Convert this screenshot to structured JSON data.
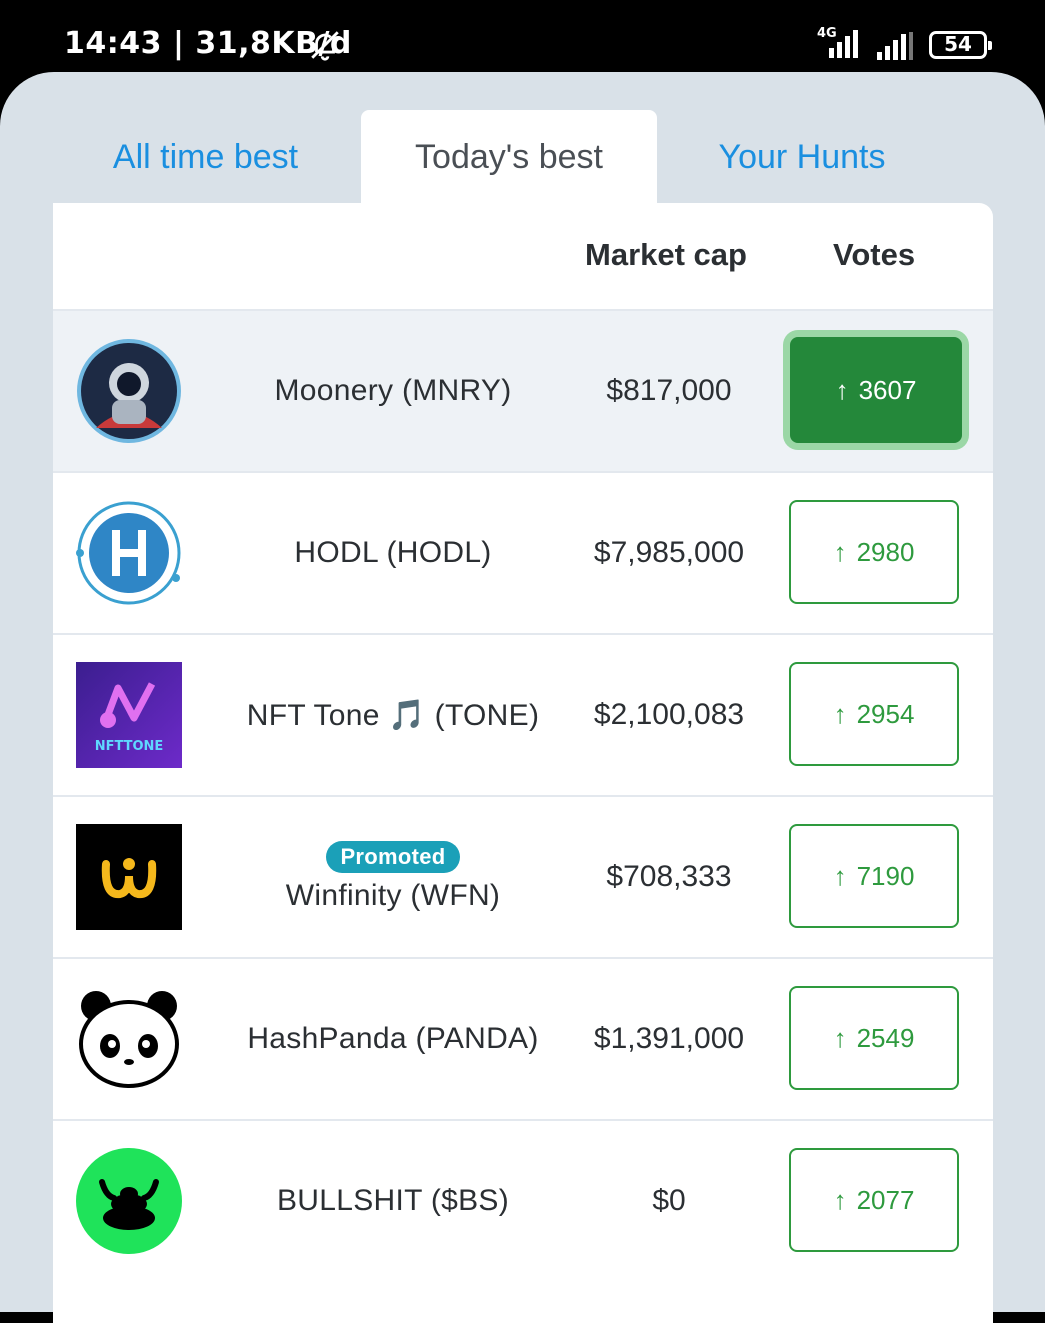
{
  "status_bar": {
    "time_speed": "14:43 | 31,8KB/d",
    "network": "4G",
    "battery": "54"
  },
  "tabs": [
    {
      "label": "All time best",
      "active": false
    },
    {
      "label": "Today's best",
      "active": true
    },
    {
      "label": "Your Hunts",
      "active": false
    }
  ],
  "table": {
    "headers": {
      "market_cap": "Market cap",
      "votes": "Votes"
    },
    "rows": [
      {
        "name": "Moonery (MNRY)",
        "market_cap": "$817,000",
        "votes": "3607",
        "voted": true,
        "promoted": false
      },
      {
        "name": "HODL (HODL)",
        "market_cap": "$7,985,000",
        "votes": "2980",
        "voted": false,
        "promoted": false
      },
      {
        "name": "NFT Tone 🎵 (TONE)",
        "market_cap": "$2,100,083",
        "votes": "2954",
        "voted": false,
        "promoted": false
      },
      {
        "name": "Winfinity (WFN)",
        "market_cap": "$708,333",
        "votes": "7190",
        "voted": false,
        "promoted": true,
        "badge": "Promoted"
      },
      {
        "name": "HashPanda (PANDA)",
        "market_cap": "$1,391,000",
        "votes": "2549",
        "voted": false,
        "promoted": false
      },
      {
        "name": "BULLSHIT ($BS)",
        "market_cap": "$0",
        "votes": "2077",
        "voted": false,
        "promoted": false
      }
    ]
  },
  "vote_arrow": "↑",
  "nft_tone_logo_text": "NFTTONE",
  "colors": {
    "accent": "#1a8fe0",
    "vote_green": "#2e9a3e",
    "voted_bg": "#24883a",
    "promo": "#1ba0b8"
  }
}
